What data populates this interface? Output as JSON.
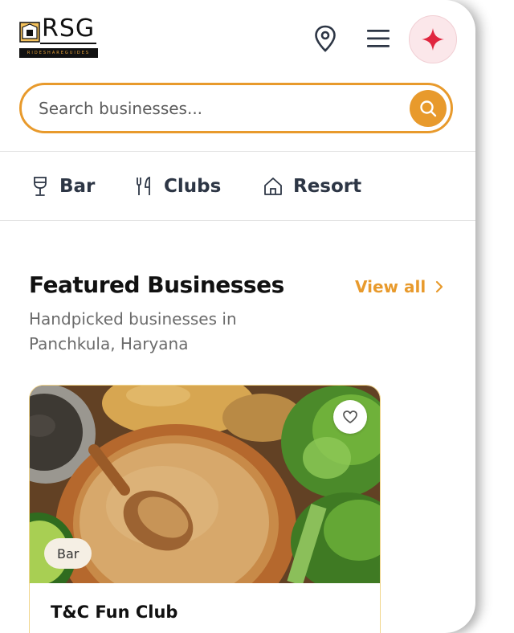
{
  "header": {
    "logo": {
      "text": "RSG",
      "tagline": "RIDESHAREGUIDES"
    },
    "icons": {
      "location": "map-pin-icon",
      "menu": "hamburger-menu-icon",
      "assistant": "sparkle-icon"
    },
    "accent_color": "#e89a2c",
    "assistant_color": "#e0263f"
  },
  "search": {
    "placeholder": "Search businesses..."
  },
  "categories": [
    {
      "label": "Bar",
      "icon": "wine-glass-icon"
    },
    {
      "label": "Clubs",
      "icon": "fork-knife-icon"
    },
    {
      "label": "Resort",
      "icon": "home-icon"
    }
  ],
  "featured": {
    "title": "Featured Businesses",
    "view_all": "View all",
    "subtitle": "Handpicked businesses in Panchkula, Haryana"
  },
  "cards": [
    {
      "title": "T&C Fun Club",
      "category": "Bar",
      "image": "grains-and-vegetables-photo",
      "favorite_icon": "heart-icon"
    }
  ]
}
